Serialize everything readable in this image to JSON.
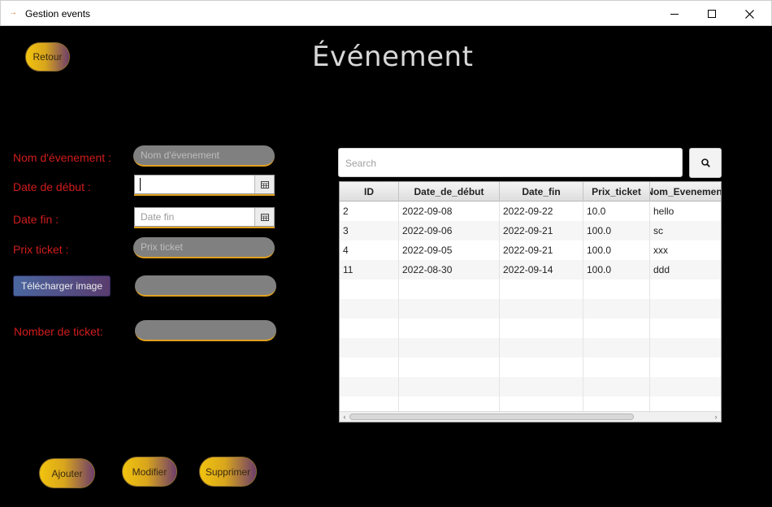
{
  "window": {
    "title": "Gestion events"
  },
  "page": {
    "title": "Événement"
  },
  "buttons": {
    "back": "Retour",
    "upload": "Télécharger image",
    "add": "Ajouter",
    "edit": "Modifier",
    "delete": "Supprimer"
  },
  "form": {
    "name_label": "Nom d'évenement :",
    "name_placeholder": "Nom d'évenement",
    "start_label": "Date de début :",
    "start_value": "",
    "end_label": "Date fin :",
    "end_placeholder": "Date fin",
    "price_label": "Prix ticket :",
    "price_placeholder": "Prix ticket",
    "image_value": "",
    "tickets_label": "Nomber de ticket:",
    "tickets_value": ""
  },
  "search": {
    "placeholder": "Search"
  },
  "table": {
    "columns": [
      "ID",
      "Date_de_début",
      "Date_fin",
      "Prix_ticket",
      "Nom_Evenement"
    ],
    "rows": [
      [
        "2",
        "2022-09-08",
        "2022-09-22",
        "10.0",
        "hello"
      ],
      [
        "3",
        "2022-09-06",
        "2022-09-21",
        "100.0",
        "sc"
      ],
      [
        "4",
        "2022-09-05",
        "2022-09-21",
        "100.0",
        "xxx"
      ],
      [
        "11",
        "2022-08-30",
        "2022-09-14",
        "100.0",
        "ddd"
      ]
    ]
  },
  "colors": {
    "background": "#000000",
    "label": "#d01c1c",
    "accent": "#e0a020",
    "title": "#d8d8d8"
  },
  "icons": {
    "calendar": "calendar-icon",
    "search": "search-icon",
    "minimize": "minimize-icon",
    "maximize": "maximize-icon",
    "close": "close-icon"
  }
}
